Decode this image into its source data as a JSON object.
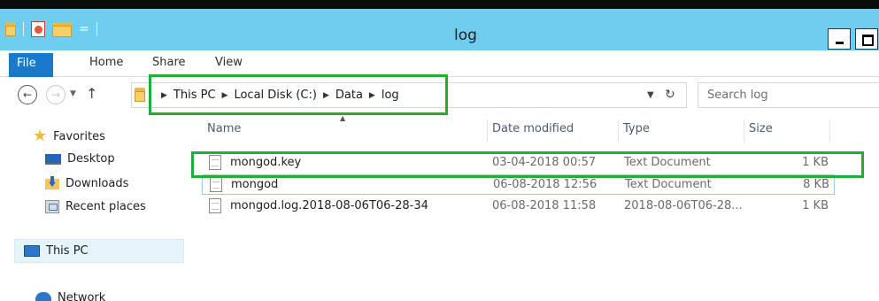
{
  "window": {
    "title": "log"
  },
  "ribbon": {
    "tabs": [
      "File",
      "Home",
      "Share",
      "View"
    ]
  },
  "address": {
    "crumbs": [
      "This PC",
      "Local Disk (C:)",
      "Data",
      "log"
    ]
  },
  "search": {
    "placeholder": "Search log"
  },
  "sidebar": {
    "favorites": "Favorites",
    "items": [
      "Desktop",
      "Downloads",
      "Recent places"
    ],
    "this_pc": "This PC",
    "network": "Network"
  },
  "list": {
    "columns": [
      "Name",
      "Date modified",
      "Type",
      "Size"
    ],
    "rows": [
      {
        "name": "mongod.key",
        "date": "03-04-2018 00:57",
        "type": "Text Document",
        "size": "1 KB"
      },
      {
        "name": "mongod",
        "date": "06-08-2018 12:56",
        "type": "Text Document",
        "size": "8 KB"
      },
      {
        "name": "mongod.log.2018-08-06T06-28-34",
        "date": "06-08-2018 11:58",
        "type": "2018-08-06T06-28...",
        "size": "1 KB"
      }
    ]
  },
  "colors": {
    "titlebar": "#6fcdf0",
    "file_tab": "#1979ca",
    "highlight": "#22ad37"
  },
  "icons": [
    "folder-icon",
    "properties-icon",
    "back-icon",
    "forward-icon",
    "up-icon",
    "refresh-icon",
    "star-icon",
    "desktop-icon",
    "downloads-icon",
    "recent-places-icon",
    "this-pc-icon",
    "network-icon",
    "text-document-icon"
  ]
}
